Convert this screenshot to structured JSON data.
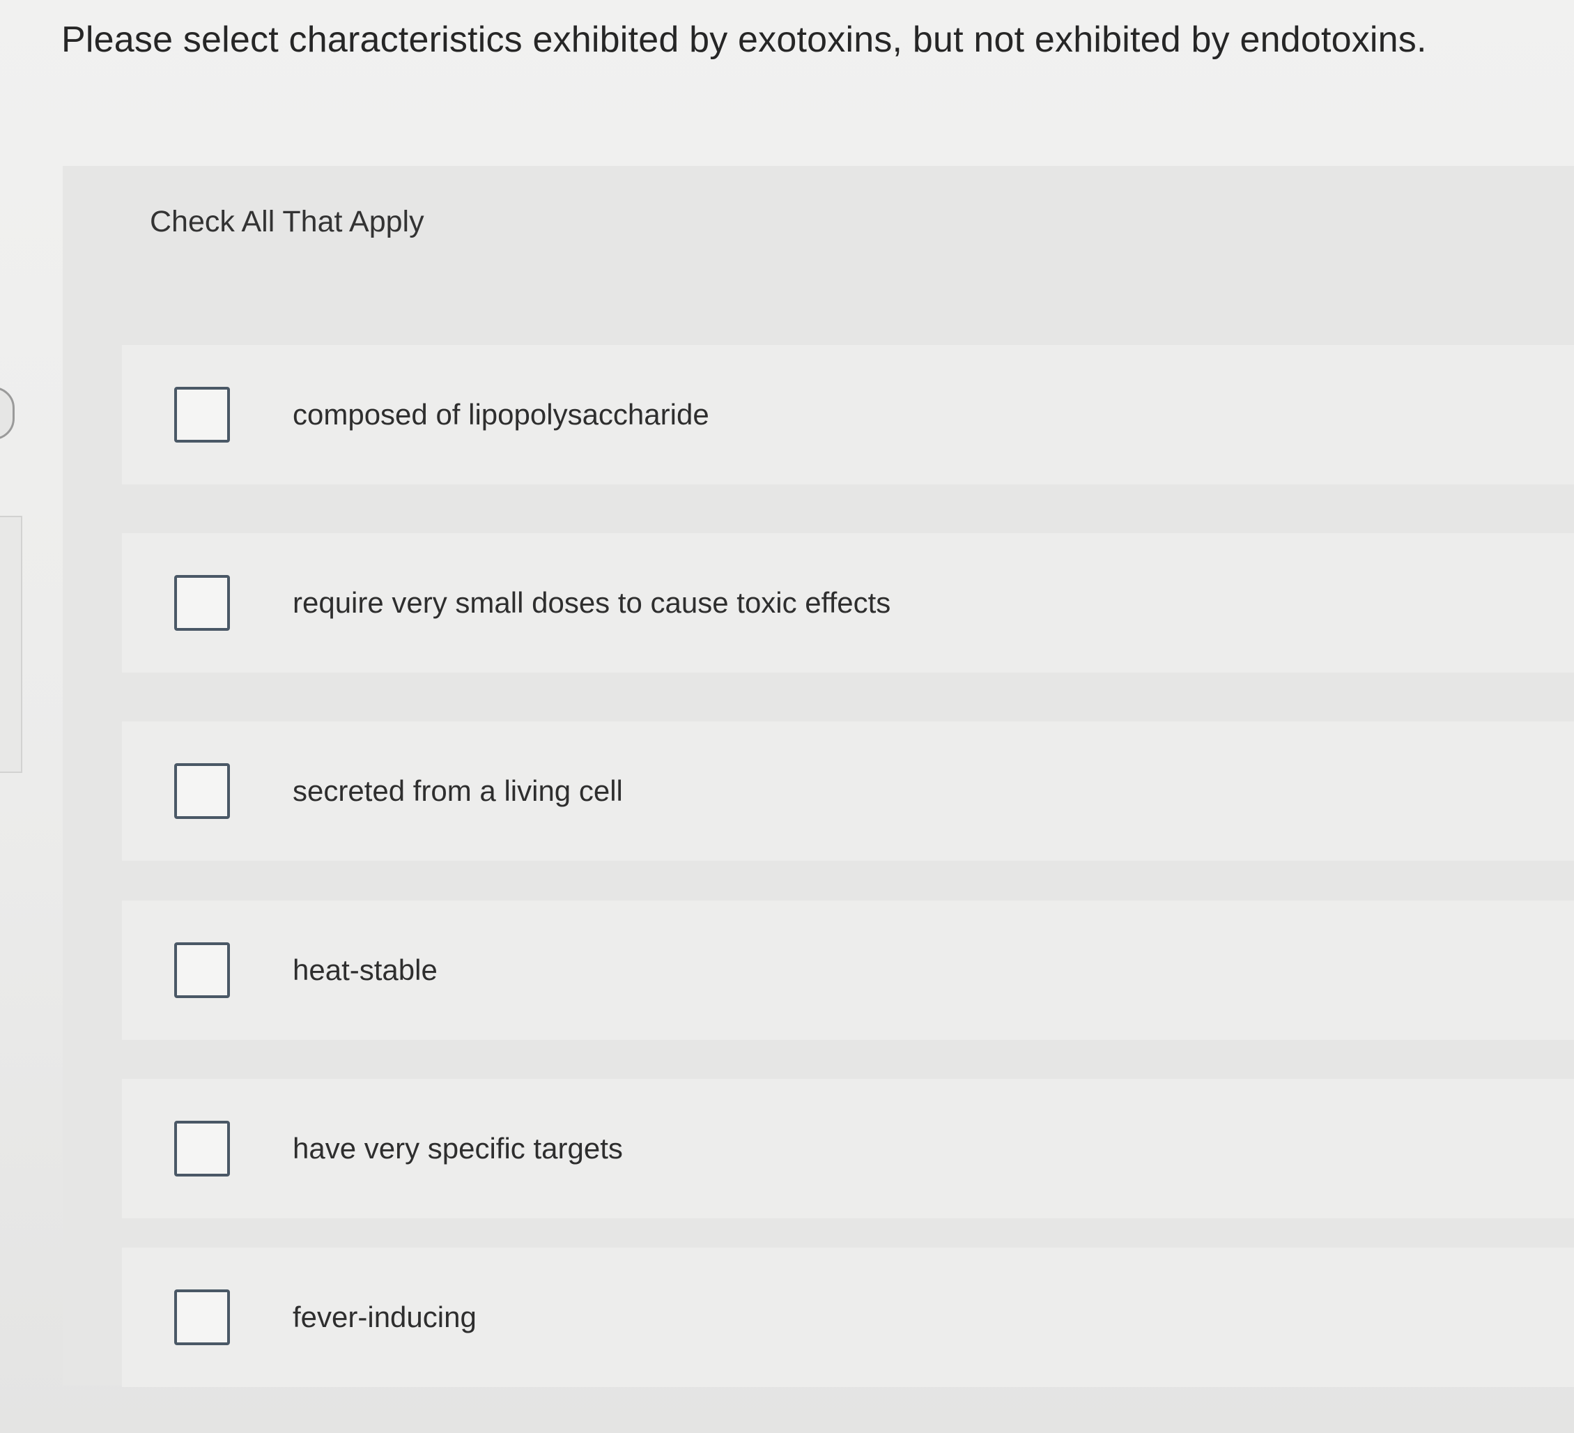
{
  "question": {
    "text": "Please select characteristics exhibited by exotoxins, but not exhibited by endotoxins."
  },
  "instruction": "Check All That Apply",
  "options": [
    {
      "label": "composed of lipopolysaccharide",
      "checked": false
    },
    {
      "label": "require very small doses to cause toxic effects",
      "checked": false
    },
    {
      "label": "secreted from a living cell",
      "checked": false
    },
    {
      "label": "heat-stable",
      "checked": false
    },
    {
      "label": "have very specific targets",
      "checked": false
    },
    {
      "label": "fever-inducing",
      "checked": false
    }
  ],
  "colors": {
    "checkbox_border": "#4a5866",
    "panel_background": "#e6e6e5",
    "option_background": "#ededec",
    "text": "#2b2b2b"
  }
}
